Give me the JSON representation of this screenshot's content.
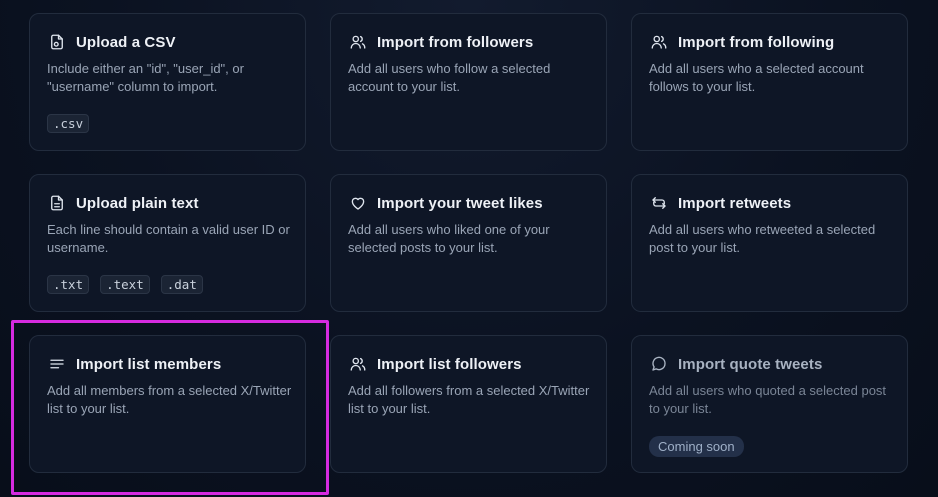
{
  "cards": [
    {
      "title": "Upload a CSV",
      "desc": "Include either an \"id\", \"user_id\", or \"username\" column to import.",
      "tags": [
        ".csv"
      ],
      "icon": "csv-file-icon"
    },
    {
      "title": "Import from followers",
      "desc": "Add all users who follow a selected account to your list.",
      "icon": "users-icon"
    },
    {
      "title": "Import from following",
      "desc": "Add all users who a selected account follows to your list.",
      "icon": "users-icon"
    },
    {
      "title": "Upload plain text",
      "desc": "Each line should contain a valid user ID or username.",
      "tags": [
        ".txt",
        ".text",
        ".dat"
      ],
      "icon": "text-file-icon"
    },
    {
      "title": "Import your tweet likes",
      "desc": "Add all users who liked one of your selected posts to your list.",
      "icon": "heart-icon"
    },
    {
      "title": "Import retweets",
      "desc": "Add all users who retweeted a selected post to your list.",
      "icon": "retweet-icon"
    },
    {
      "title": "Import list members",
      "desc": "Add all members from a selected X/Twitter list to your list.",
      "icon": "list-icon"
    },
    {
      "title": "Import list followers",
      "desc": "Add all followers from a selected X/Twitter list to your list.",
      "icon": "users-icon"
    },
    {
      "title": "Import quote tweets",
      "desc": "Add all users who quoted a selected post to your list.",
      "badge": "Coming soon",
      "icon": "message-circle-icon"
    }
  ],
  "colors": {
    "highlight": "#d62be0",
    "background": "#0b1221",
    "card_border": "#222c3d"
  }
}
